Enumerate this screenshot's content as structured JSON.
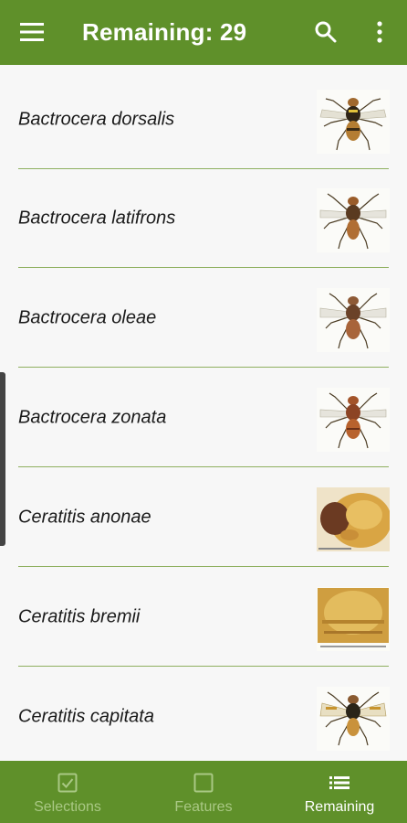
{
  "appbar": {
    "title": "Remaining: 29",
    "menu_icon": "menu-icon",
    "search_icon": "search-icon",
    "more_icon": "more-vert-icon",
    "color": "#5f902a"
  },
  "species": [
    {
      "name": "Bactrocera dorsalis",
      "thumb": "fly-specimen-dorsal"
    },
    {
      "name": "Bactrocera latifrons",
      "thumb": "fly-specimen-dorsal"
    },
    {
      "name": "Bactrocera oleae",
      "thumb": "fly-specimen-dorsal"
    },
    {
      "name": "Bactrocera zonata",
      "thumb": "fly-specimen-dorsal"
    },
    {
      "name": "Ceratitis anonae",
      "thumb": "fly-thorax-closeup"
    },
    {
      "name": "Ceratitis bremii",
      "thumb": "fly-abdomen-closeup"
    },
    {
      "name": "Ceratitis capitata",
      "thumb": "fly-specimen-dorsal"
    }
  ],
  "bottom_nav": [
    {
      "label": "Selections",
      "icon": "checkbox-checked-icon",
      "active": false
    },
    {
      "label": "Features",
      "icon": "checkbox-empty-icon",
      "active": false
    },
    {
      "label": "Remaining",
      "icon": "list-icon",
      "active": true
    }
  ]
}
